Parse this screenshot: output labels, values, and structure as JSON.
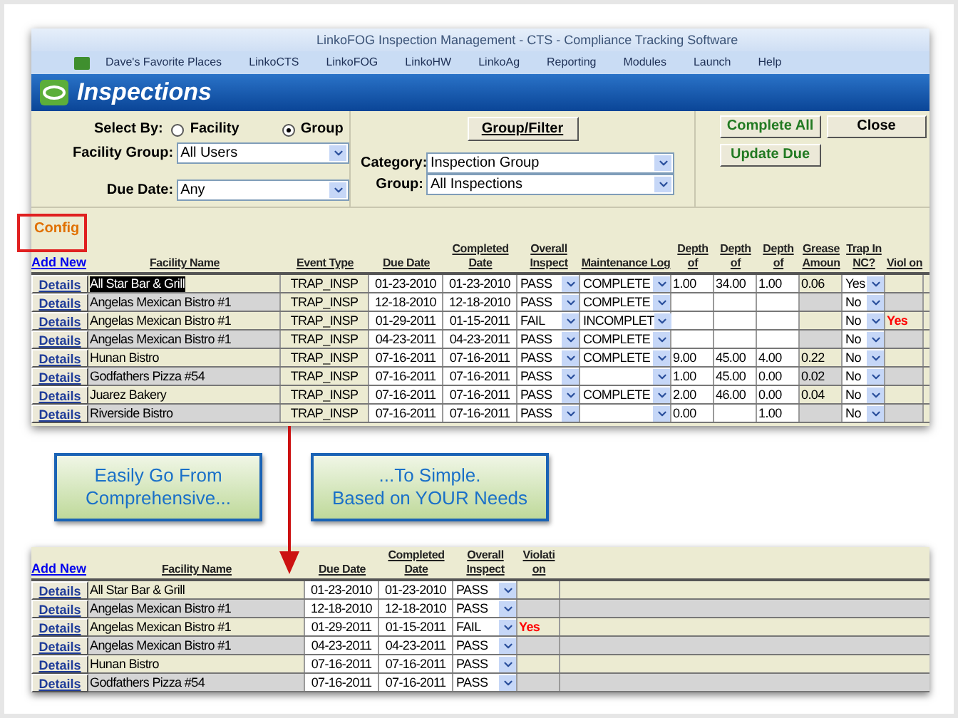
{
  "window": {
    "title": "LinkoFOG Inspection Management  -  CTS  -  Compliance Tracking Software"
  },
  "menu": [
    "Dave's Favorite Places",
    "LinkoCTS",
    "LinkoFOG",
    "LinkoHW",
    "LinkoAg",
    "Reporting",
    "Modules",
    "Launch",
    "Help"
  ],
  "page_title": "Inspections",
  "filters": {
    "select_by": {
      "label": "Select By:",
      "options": [
        {
          "label": "Facility",
          "selected": false
        },
        {
          "label": "Group",
          "selected": true
        }
      ]
    },
    "facility_group": {
      "label": "Facility Group:",
      "value": "All Users"
    },
    "due_date": {
      "label": "Due Date:",
      "value": "Any"
    },
    "group_filter_button": "Group/Filter",
    "category": {
      "label": "Category:",
      "value": "Inspection Group"
    },
    "group": {
      "label": "Group:",
      "value": "All Inspections"
    }
  },
  "buttons": [
    {
      "label": "Complete All",
      "kind": "action"
    },
    {
      "label": "Close",
      "kind": "plain"
    },
    {
      "label": "Update Due",
      "kind": "action"
    }
  ],
  "config_link": "Config",
  "add_new_link": "Add New",
  "table": {
    "columns": [
      {
        "label": "Facility Name",
        "kind": "name"
      },
      {
        "label": "Event Type",
        "kind": "event"
      },
      {
        "label": "Due Date",
        "kind": "date"
      },
      {
        "label": "Completed Date",
        "kind": "date"
      },
      {
        "label": "Overall Inspect",
        "kind": "select"
      },
      {
        "label": "Maintenance Log",
        "kind": "select"
      },
      {
        "label": "Depth of",
        "kind": "number"
      },
      {
        "label": "Depth of",
        "kind": "number"
      },
      {
        "label": "Depth of",
        "kind": "number"
      },
      {
        "label": "Grease Amoun",
        "kind": "grease"
      },
      {
        "label": "Trap In NC?",
        "kind": "select"
      },
      {
        "label": "Viol on",
        "kind": "violation"
      }
    ],
    "rows": [
      {
        "details": "Details",
        "selected": true,
        "cells": [
          "All Star Bar & Grill",
          "TRAP_INSP",
          "01-23-2010",
          "01-23-2010",
          "PASS",
          "COMPLETE",
          "1.00",
          "34.00",
          "1.00",
          "0.06",
          "Yes",
          null
        ]
      },
      {
        "details": "Details",
        "selected": false,
        "cells": [
          "Angelas Mexican Bistro #1",
          "TRAP_INSP",
          "12-18-2010",
          "12-18-2010",
          "PASS",
          "COMPLETE",
          null,
          null,
          null,
          null,
          "No",
          null
        ]
      },
      {
        "details": "Details",
        "selected": false,
        "cells": [
          "Angelas Mexican Bistro #1",
          "TRAP_INSP",
          "01-29-2011",
          "01-15-2011",
          "FAIL",
          "INCOMPLET",
          null,
          null,
          null,
          null,
          "No",
          "Yes"
        ]
      },
      {
        "details": "Details",
        "selected": false,
        "cells": [
          "Angelas Mexican Bistro #1",
          "TRAP_INSP",
          "04-23-2011",
          "04-23-2011",
          "PASS",
          "COMPLETE",
          null,
          null,
          null,
          null,
          "No",
          null
        ]
      },
      {
        "details": "Details",
        "selected": false,
        "cells": [
          "Hunan Bistro",
          "TRAP_INSP",
          "07-16-2011",
          "07-16-2011",
          "PASS",
          "COMPLETE",
          "9.00",
          "45.00",
          "4.00",
          "0.22",
          "No",
          null
        ]
      },
      {
        "details": "Details",
        "selected": false,
        "cells": [
          "Godfathers Pizza  #54",
          "TRAP_INSP",
          "07-16-2011",
          "07-16-2011",
          "PASS",
          null,
          "1.00",
          "45.00",
          "0.00",
          "0.02",
          "No",
          null
        ]
      },
      {
        "details": "Details",
        "selected": false,
        "cells": [
          "Juarez Bakery",
          "TRAP_INSP",
          "07-16-2011",
          "07-16-2011",
          "PASS",
          "COMPLETE",
          "2.00",
          "46.00",
          "0.00",
          "0.04",
          "No",
          null
        ]
      },
      {
        "details": "Details",
        "selected": false,
        "cells": [
          "Riverside Bistro",
          "TRAP_INSP",
          "07-16-2011",
          "07-16-2011",
          "PASS",
          null,
          "0.00",
          null,
          "1.00",
          null,
          "No",
          null
        ]
      }
    ]
  },
  "callouts": [
    "Easily Go From\nComprehensive...",
    "...To Simple.\nBased on YOUR Needs"
  ],
  "simple_table": {
    "add_new_link": "Add New",
    "columns": [
      {
        "label": "Facility Name",
        "kind": "name"
      },
      {
        "label": "Due Date",
        "kind": "date"
      },
      {
        "label": "Completed Date",
        "kind": "date"
      },
      {
        "label": "Overall Inspect",
        "kind": "select"
      },
      {
        "label": "Violati on",
        "kind": "violation"
      }
    ],
    "rows": [
      {
        "details": "Details",
        "cells": [
          "All Star Bar & Grill",
          "01-23-2010",
          "01-23-2010",
          "PASS",
          null
        ]
      },
      {
        "details": "Details",
        "cells": [
          "Angelas Mexican Bistro #1",
          "12-18-2010",
          "12-18-2010",
          "PASS",
          null
        ]
      },
      {
        "details": "Details",
        "cells": [
          "Angelas Mexican Bistro #1",
          "01-29-2011",
          "01-15-2011",
          "FAIL",
          "Yes"
        ]
      },
      {
        "details": "Details",
        "cells": [
          "Angelas Mexican Bistro #1",
          "04-23-2011",
          "04-23-2011",
          "PASS",
          null
        ]
      },
      {
        "details": "Details",
        "cells": [
          "Hunan Bistro",
          "07-16-2011",
          "07-16-2011",
          "PASS",
          null
        ]
      },
      {
        "details": "Details",
        "cells": [
          "Godfathers Pizza  #54",
          "07-16-2011",
          "07-16-2011",
          "PASS",
          null
        ]
      }
    ]
  }
}
